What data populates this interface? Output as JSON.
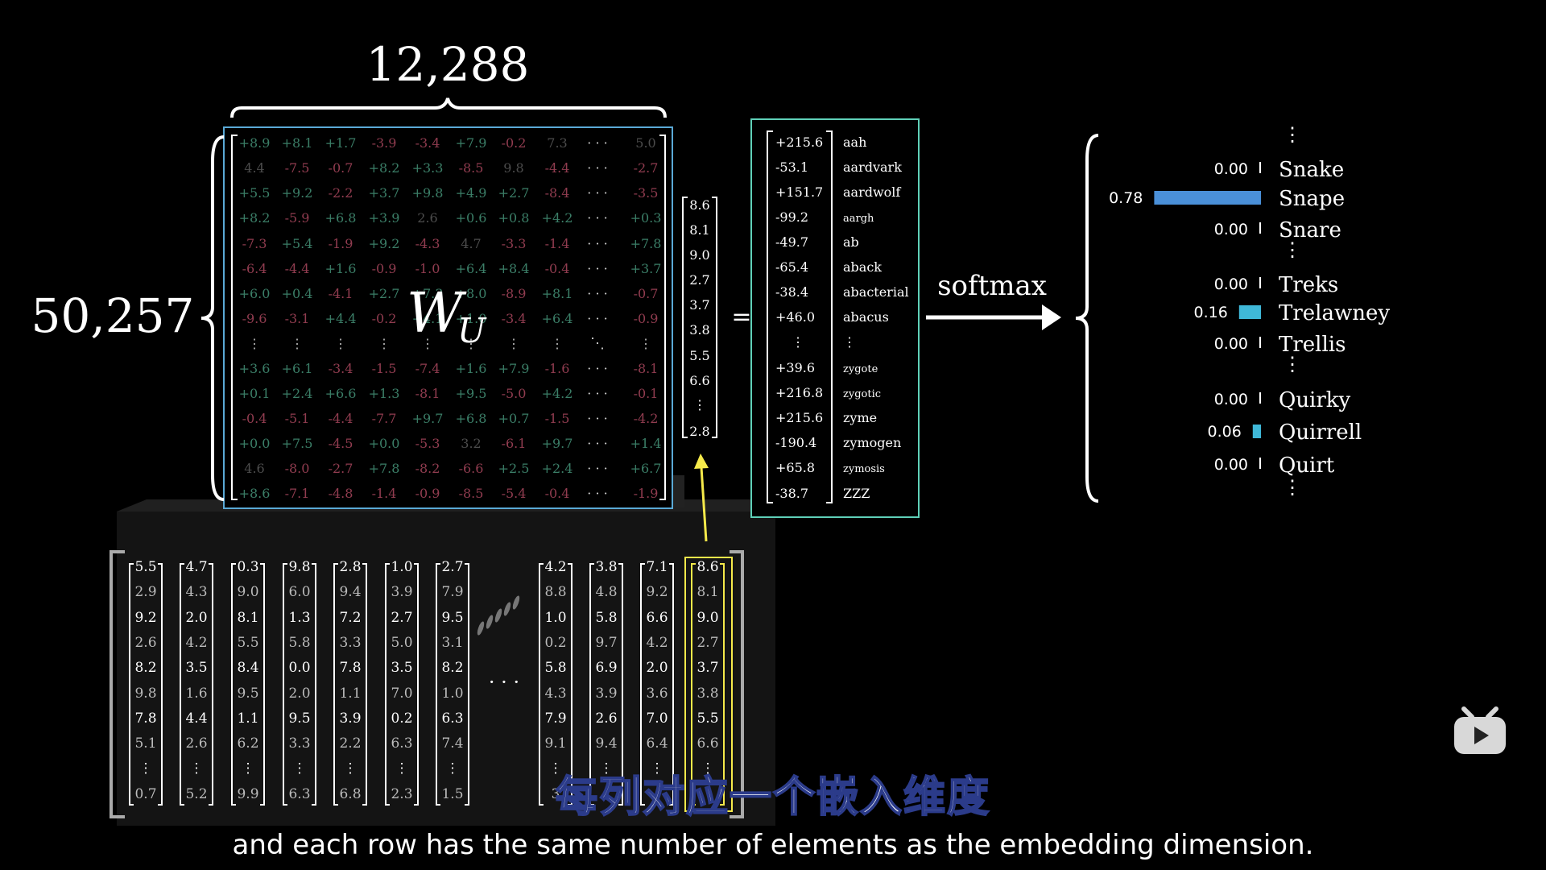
{
  "labels": {
    "cols_count": "12,288",
    "rows_count": "50,257",
    "matrix_symbol": "W",
    "matrix_subscript": "U",
    "equals": "=",
    "softmax": "softmax"
  },
  "matrix": {
    "rows": [
      [
        "+8.9",
        "+8.1",
        "+1.7",
        "-3.9",
        "-3.4",
        "+7.9",
        "-0.2",
        "7.3",
        "5.0"
      ],
      [
        "4.4",
        "-7.5",
        "-0.7",
        "+8.2",
        "+3.3",
        "-8.5",
        "9.8",
        "-4.4",
        "-2.7"
      ],
      [
        "+5.5",
        "+9.2",
        "-2.2",
        "+3.7",
        "+9.8",
        "+4.9",
        "+2.7",
        "-8.4",
        "-3.5"
      ],
      [
        "+8.2",
        "-5.9",
        "+6.8",
        "+3.9",
        "2.6",
        "+0.6",
        "+0.8",
        "+4.2",
        "+0.3"
      ],
      [
        "-7.3",
        "+5.4",
        "-1.9",
        "+9.2",
        "-4.3",
        "4.7",
        "-3.3",
        "-1.4",
        "+7.8"
      ],
      [
        "-6.4",
        "-4.4",
        "+1.6",
        "-0.9",
        "-1.0",
        "+6.4",
        "+8.4",
        "-0.4",
        "+3.7"
      ],
      [
        "+6.0",
        "+0.4",
        "-4.1",
        "+2.7",
        "+7.3",
        "+8.0",
        "-8.9",
        "+8.1",
        "-0.7"
      ],
      [
        "-9.6",
        "-3.1",
        "+4.4",
        "-0.2",
        "+4.1",
        "+1.0",
        "-3.4",
        "+6.4",
        "-0.9"
      ],
      [
        "⋮",
        "⋮",
        "⋮",
        "⋮",
        "⋮",
        "⋮",
        "⋮",
        "⋮",
        "⋮"
      ],
      [
        "+3.6",
        "+6.1",
        "-3.4",
        "-1.5",
        "-7.4",
        "+1.6",
        "+7.9",
        "-1.6",
        "-8.1"
      ],
      [
        "+0.1",
        "+2.4",
        "+6.6",
        "+1.3",
        "-8.1",
        "+9.5",
        "-5.0",
        "+4.2",
        "-0.1"
      ],
      [
        "-0.4",
        "-5.1",
        "-4.4",
        "-7.7",
        "+9.7",
        "+6.8",
        "+0.7",
        "-1.5",
        "-4.2"
      ],
      [
        "+0.0",
        "+7.5",
        "-4.5",
        "+0.0",
        "-5.3",
        "3.2",
        "-6.1",
        "+9.7",
        "+1.4"
      ],
      [
        "4.6",
        "-8.0",
        "-2.7",
        "+7.8",
        "-8.2",
        "-6.6",
        "+2.5",
        "+2.4",
        "+6.7"
      ],
      [
        "+8.6",
        "-7.1",
        "-4.8",
        "-1.4",
        "-0.9",
        "-8.5",
        "-5.4",
        "-0.4",
        "-1.9"
      ]
    ],
    "dots_col": "· · ·",
    "diag_dots": "⋱"
  },
  "vector": {
    "values": [
      "8.6",
      "8.1",
      "9.0",
      "2.7",
      "3.7",
      "3.8",
      "5.5",
      "6.6",
      "⋮",
      "2.8"
    ]
  },
  "logits": {
    "values": [
      "+215.6",
      "-53.1",
      "+151.7",
      "-99.2",
      "-49.7",
      "-65.4",
      "-38.4",
      "+46.0",
      "⋮",
      "+39.6",
      "+216.8",
      "+215.6",
      "-190.4",
      "+65.8",
      "-38.7"
    ],
    "words": [
      "aah",
      "aardvark",
      "aardwolf",
      "aargh",
      "ab",
      "aback",
      "abacterial",
      "abacus",
      "⋮",
      "zygote",
      "zygotic",
      "zyme",
      "zymogen",
      "zymosis",
      "ZZZ"
    ]
  },
  "probabilities": {
    "vdots": "⋮",
    "items": [
      {
        "label": "Snake",
        "value": "0.00",
        "fraction": 0.0,
        "color": "#ffffff"
      },
      {
        "label": "Snape",
        "value": "0.78",
        "fraction": 0.78,
        "color": "#4a90d9"
      },
      {
        "label": "Snare",
        "value": "0.00",
        "fraction": 0.0,
        "color": "#ffffff"
      },
      {
        "label": "Treks",
        "value": "0.00",
        "fraction": 0.0,
        "color": "#ffffff"
      },
      {
        "label": "Trelawney",
        "value": "0.16",
        "fraction": 0.16,
        "color": "#3fb8d8"
      },
      {
        "label": "Trellis",
        "value": "0.00",
        "fraction": 0.0,
        "color": "#ffffff"
      },
      {
        "label": "Quirky",
        "value": "0.00",
        "fraction": 0.0,
        "color": "#ffffff"
      },
      {
        "label": "Quirrell",
        "value": "0.06",
        "fraction": 0.06,
        "color": "#3fb8d8"
      },
      {
        "label": "Quirt",
        "value": "0.00",
        "fraction": 0.0,
        "color": "#ffffff"
      }
    ]
  },
  "embedding_columns": {
    "columns": [
      [
        "5.5",
        "2.9",
        "9.2",
        "2.6",
        "8.2",
        "9.8",
        "7.8",
        "5.1",
        "⋮",
        "0.7"
      ],
      [
        "4.7",
        "4.3",
        "2.0",
        "4.2",
        "3.5",
        "1.6",
        "4.4",
        "2.6",
        "⋮",
        "5.2"
      ],
      [
        "0.3",
        "9.0",
        "8.1",
        "5.5",
        "8.4",
        "9.5",
        "1.1",
        "6.2",
        "⋮",
        "9.9"
      ],
      [
        "9.8",
        "6.0",
        "1.3",
        "5.8",
        "0.0",
        "2.0",
        "9.5",
        "3.3",
        "⋮",
        "6.3"
      ],
      [
        "2.8",
        "9.4",
        "7.2",
        "3.3",
        "7.8",
        "1.1",
        "3.9",
        "2.2",
        "⋮",
        "6.8"
      ],
      [
        "1.0",
        "3.9",
        "2.7",
        "5.0",
        "3.5",
        "7.0",
        "0.2",
        "6.3",
        "⋮",
        "2.3"
      ],
      [
        "2.7",
        "7.9",
        "9.5",
        "3.1",
        "8.2",
        "1.0",
        "6.3",
        "7.4",
        "⋮",
        "1.5"
      ],
      [
        "4.2",
        "8.8",
        "1.0",
        "0.2",
        "5.8",
        "4.3",
        "7.9",
        "9.1",
        "⋮",
        "3"
      ],
      [
        "3.8",
        "4.8",
        "5.8",
        "9.7",
        "6.9",
        "3.9",
        "2.6",
        "9.4",
        "⋮",
        ""
      ],
      [
        "7.1",
        "9.2",
        "6.6",
        "4.2",
        "2.0",
        "3.6",
        "7.0",
        "6.4",
        "⋮",
        ""
      ],
      [
        "8.6",
        "8.1",
        "9.0",
        "2.7",
        "3.7",
        "3.8",
        "5.5",
        "6.6",
        "⋮",
        ""
      ]
    ],
    "ellipsis": "· · ·"
  },
  "captions": {
    "zh": "每列对应一个嵌入维度",
    "en": "and each row has the same number of elements as the embedding dimension."
  },
  "colors": {
    "matrix_border": "#5aa9d6",
    "logits_border": "#5fd0b8",
    "highlight": "#f5e94a",
    "positive": "#4fa88a",
    "negative": "#c0506a"
  }
}
